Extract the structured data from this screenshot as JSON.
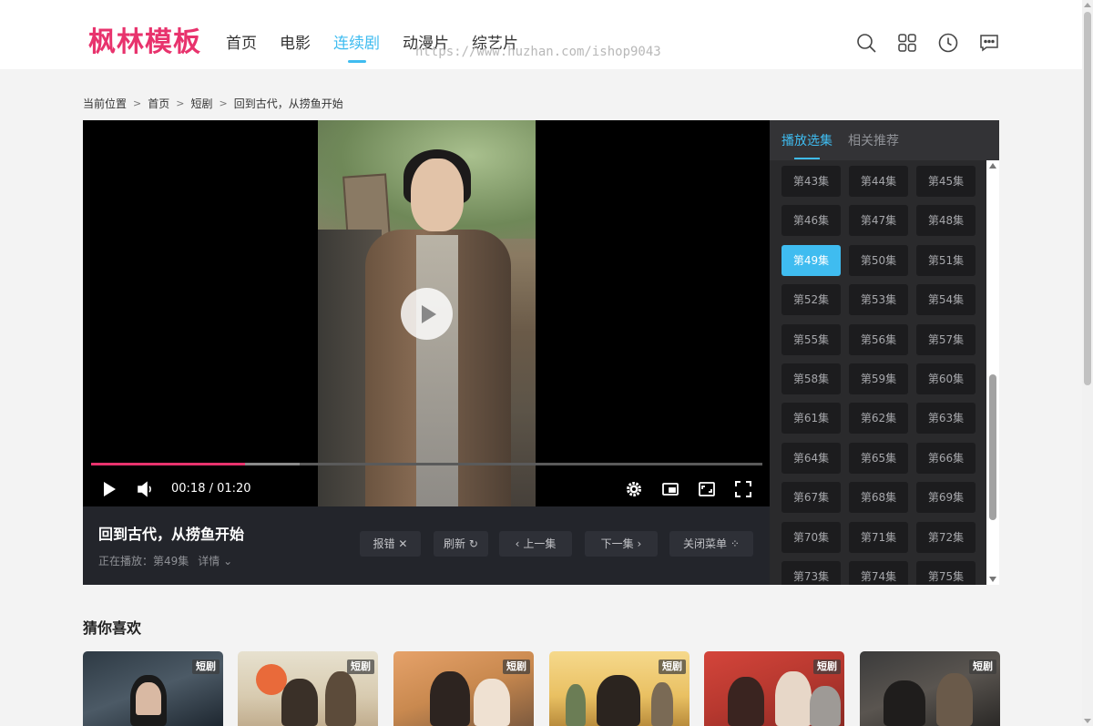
{
  "header": {
    "logo": "枫林模板",
    "nav": [
      "首页",
      "电影",
      "连续剧",
      "动漫片",
      "综艺片"
    ],
    "active_nav": "连续剧",
    "watermark": "https://www.huzhan.com/ishop9043",
    "icons": [
      "search-icon",
      "apps-icon",
      "history-icon",
      "message-icon"
    ],
    "accent_color": "#3fbcf0",
    "logo_color": "#e8336d"
  },
  "breadcrumb": [
    "当前位置",
    "首页",
    "短剧",
    "回到古代，从捞鱼开始"
  ],
  "player": {
    "current_time": "00:18",
    "duration": "01:20",
    "time_display": "00:18 / 01:20",
    "progress": 0.229,
    "icons": [
      "play-icon",
      "volume-icon",
      "settings-icon",
      "pip-icon",
      "web-fullscreen-icon",
      "fullscreen-icon"
    ]
  },
  "info": {
    "title": "回到古代，从捞鱼开始",
    "playing_label": "正在播放：第49集",
    "detail_label": "详情",
    "buttons": {
      "report": "报错",
      "refresh": "刷新",
      "prev": "上一集",
      "next": "下一集",
      "close_menu": "关闭菜单"
    }
  },
  "sidebar": {
    "tabs": [
      "播放选集",
      "相关推荐"
    ],
    "active_tab": "播放选集",
    "episodes": [
      "第43集",
      "第44集",
      "第45集",
      "第46集",
      "第47集",
      "第48集",
      "第49集",
      "第50集",
      "第51集",
      "第52集",
      "第53集",
      "第54集",
      "第55集",
      "第56集",
      "第57集",
      "第58集",
      "第59集",
      "第60集",
      "第61集",
      "第62集",
      "第63集",
      "第64集",
      "第65集",
      "第66集",
      "第67集",
      "第68集",
      "第69集",
      "第70集",
      "第71集",
      "第72集",
      "第73集",
      "第74集",
      "第75集"
    ],
    "active_episode": "第49集"
  },
  "recommend": {
    "title": "猜你喜欢",
    "cards": [
      {
        "tag": "短剧"
      },
      {
        "tag": "短剧"
      },
      {
        "tag": "短剧"
      },
      {
        "tag": "短剧"
      },
      {
        "tag": "短剧"
      },
      {
        "tag": "短剧"
      }
    ]
  }
}
